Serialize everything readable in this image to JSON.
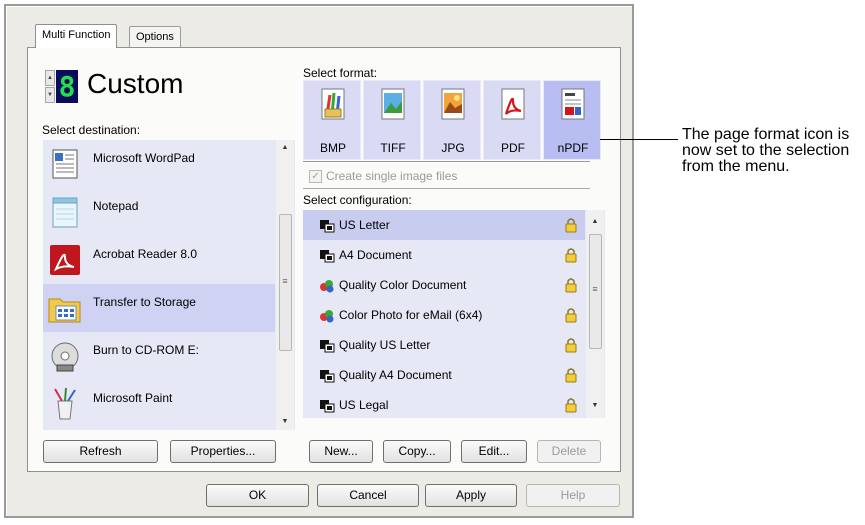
{
  "tabs": [
    {
      "label": "Multi Function"
    },
    {
      "label": "Options"
    }
  ],
  "header": {
    "digit": "8",
    "title": "Custom"
  },
  "destination": {
    "label": "Select destination:",
    "items": [
      {
        "label": "Microsoft WordPad",
        "icon": "wordpad-icon"
      },
      {
        "label": "Notepad",
        "icon": "notepad-icon"
      },
      {
        "label": "Acrobat Reader 8.0",
        "icon": "acrobat-icon"
      },
      {
        "label": "Transfer to Storage",
        "icon": "folder-icon",
        "selected": true
      },
      {
        "label": "Burn to CD-ROM  E:",
        "icon": "cd-icon"
      },
      {
        "label": "Microsoft Paint",
        "icon": "paint-icon"
      }
    ],
    "refresh_label": "Refresh",
    "properties_label": "Properties..."
  },
  "format": {
    "label": "Select format:",
    "items": [
      {
        "label": "BMP",
        "icon": "bmp-icon"
      },
      {
        "label": "TIFF",
        "icon": "tiff-icon"
      },
      {
        "label": "JPG",
        "icon": "jpg-icon"
      },
      {
        "label": "PDF",
        "icon": "pdf-icon"
      },
      {
        "label": "nPDF",
        "icon": "npdf-icon",
        "selected": true
      }
    ],
    "checkbox_label": "Create single image files"
  },
  "configuration": {
    "label": "Select configuration:",
    "items": [
      {
        "label": "US Letter",
        "icon": "bw-config-icon",
        "selected": true
      },
      {
        "label": "A4 Document",
        "icon": "bw-config-icon"
      },
      {
        "label": "Quality Color Document",
        "icon": "color-config-icon"
      },
      {
        "label": "Color Photo for eMail (6x4)",
        "icon": "color-config-icon"
      },
      {
        "label": "Quality US Letter",
        "icon": "bw-config-icon"
      },
      {
        "label": "Quality A4 Document",
        "icon": "bw-config-icon"
      },
      {
        "label": "US Legal",
        "icon": "bw-config-icon"
      }
    ],
    "new_label": "New...",
    "copy_label": "Copy...",
    "edit_label": "Edit...",
    "delete_label": "Delete"
  },
  "footer": {
    "ok_label": "OK",
    "cancel_label": "Cancel",
    "apply_label": "Apply",
    "help_label": "Help"
  },
  "annotation": {
    "text": "The page format icon is now set to the selection from the menu."
  },
  "colors": {
    "list_bg": "#e6e8f6",
    "selected_bg": "#cfd2f2",
    "format_bg": "#d9dbf5",
    "digit_bg": "#0b0b5e",
    "digit_fg": "#21e04c"
  }
}
